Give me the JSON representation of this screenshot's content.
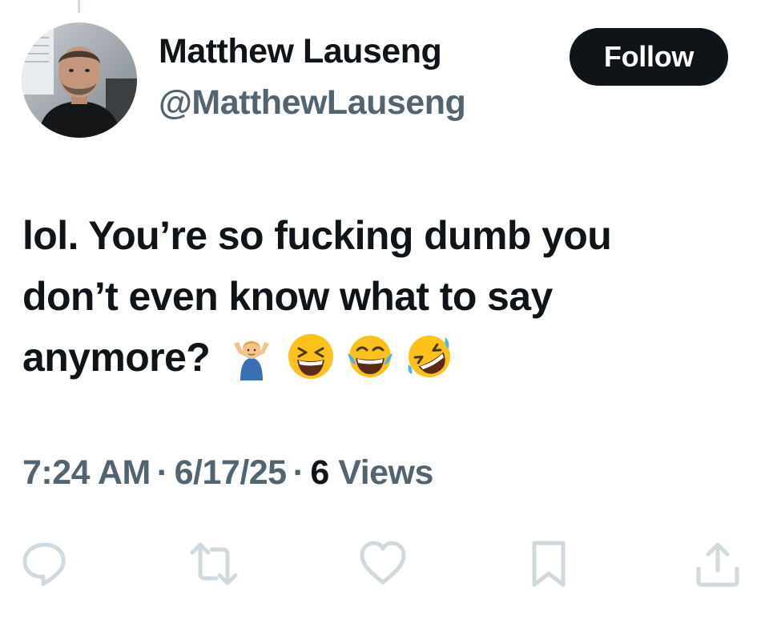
{
  "tweet": {
    "author": {
      "name": "Matthew Lauseng",
      "handle": "@MatthewLauseng"
    },
    "follow_label": "Follow",
    "text": {
      "line1": "lol. You’re so fucking dumb you",
      "line2": "don’t even know what to say",
      "line3": "anymore?",
      "emojis": [
        "person-shrugging",
        "grinning-squinting-face",
        "face-with-tears-of-joy",
        "rolling-on-the-floor-laughing"
      ]
    },
    "meta": {
      "time": "7:24 AM",
      "separator": "·",
      "date": "6/17/25",
      "views_count": "6",
      "views_label": "Views"
    },
    "actions": [
      {
        "name": "reply",
        "icon": "reply-icon"
      },
      {
        "name": "retweet",
        "icon": "retweet-icon"
      },
      {
        "name": "like",
        "icon": "heart-icon"
      },
      {
        "name": "bookmark",
        "icon": "bookmark-icon"
      },
      {
        "name": "share",
        "icon": "share-icon"
      }
    ]
  },
  "colors": {
    "primary_text": "#0f1419",
    "secondary_text": "#536471",
    "icon": "#cfd9de",
    "follow_bg": "#0f1419"
  }
}
